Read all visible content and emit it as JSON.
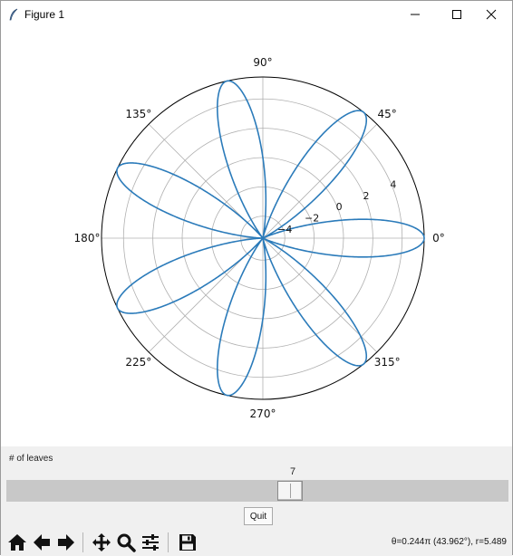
{
  "window": {
    "title": "Figure 1",
    "icons": {
      "app": "feather-icon",
      "minimize": "minimize-icon",
      "maximize": "maximize-icon",
      "close": "close-icon"
    }
  },
  "chart_data": {
    "type": "line",
    "projection": "polar",
    "curve": "rose",
    "series": [
      {
        "equation": "r = a*cos(k*theta)",
        "k": 7,
        "a": 5.5,
        "color": "#2b7bba"
      }
    ],
    "angular_ticks": [
      "0°",
      "45°",
      "90°",
      "135°",
      "180°",
      "225°",
      "270°",
      "315°"
    ],
    "angular_tick_degrees": [
      0,
      45,
      90,
      135,
      180,
      225,
      270,
      315
    ],
    "radial_ticks": [
      "−4",
      "−2",
      "0",
      "2",
      "4"
    ],
    "radial_tick_values": [
      -4,
      -2,
      0,
      2,
      4
    ],
    "rlim": [
      -5.5,
      5.5
    ],
    "grid": true,
    "legend": "none"
  },
  "slider": {
    "label": "# of leaves",
    "value": "7",
    "min": 1,
    "max": 14,
    "fraction": 0.565
  },
  "quit_button": {
    "label": "Quit"
  },
  "toolbar": {
    "icons": [
      "home-icon",
      "back-icon",
      "forward-icon",
      "pan-icon",
      "zoom-icon",
      "configure-subplots-icon",
      "save-icon"
    ],
    "coords_text": "θ=0.244π (43.962°), r=5.489"
  }
}
